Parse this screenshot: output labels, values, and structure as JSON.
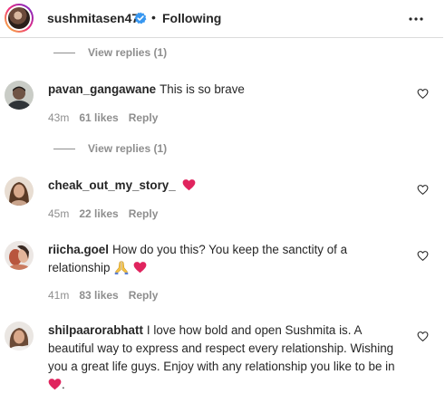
{
  "header": {
    "username": "sushmitasen47",
    "separator": "•",
    "follow_status": "Following"
  },
  "view_replies_label": "View replies (1)",
  "comments": [
    {
      "username": "pavan_gangawane",
      "text": "This is so brave",
      "time": "43m",
      "likes": "61 likes",
      "reply": "Reply"
    },
    {
      "username": "cheak_out_my_story_",
      "text": "",
      "time": "45m",
      "likes": "22 likes",
      "reply": "Reply"
    },
    {
      "username": "riicha.goel",
      "text": "How do you this? You keep the sanctity of a relationship",
      "time": "41m",
      "likes": "83 likes",
      "reply": "Reply"
    },
    {
      "username": "shilpaarorabhatt",
      "text": "I love how bold and open Sushmita is. A beautiful way to express and respect every relationship. Wishing you a great life guys. Enjoy with any relationship you like to be in",
      "text_end": "."
    }
  ],
  "icons": {
    "verified": "verified-badge-icon",
    "more": "more-options-icon",
    "like": "heart-outline-icon",
    "emoji_heart": "red-heart-emoji",
    "emoji_pray": "folded-hands-emoji"
  },
  "colors": {
    "verified_blue": "#3897f0",
    "heart_red": "#e0245e",
    "muted_text": "#8e8e8e"
  }
}
